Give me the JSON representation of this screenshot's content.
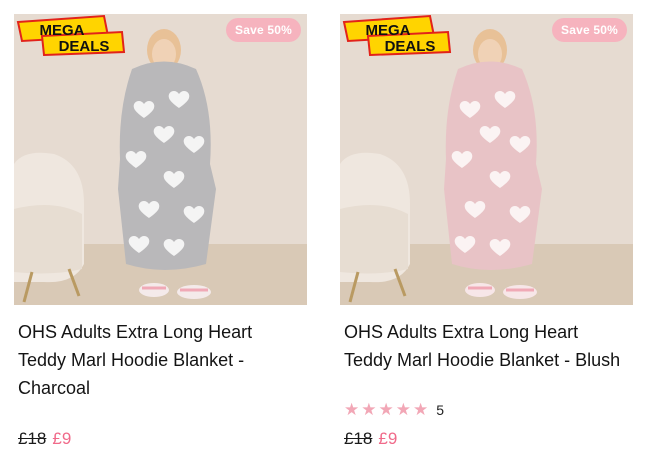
{
  "products": [
    {
      "badge": "Save 50%",
      "promo_top": "MEGA",
      "promo_bottom": "DEALS",
      "title": "OHS Adults Extra Long Heart Teddy Marl Hoodie Blanket - Charcoal",
      "old_price": "£18",
      "new_price": "£9",
      "color": "#b9b8ba"
    },
    {
      "badge": "Save 50%",
      "promo_top": "MEGA",
      "promo_bottom": "DEALS",
      "title": "OHS Adults Extra Long Heart Teddy Marl Hoodie Blanket - Blush",
      "rating_count": "5",
      "stars": 5,
      "old_price": "£18",
      "new_price": "£9",
      "color": "#e8c3c6"
    }
  ],
  "colors": {
    "accent_pink": "#f06a8a",
    "badge_pink": "#f6b3be",
    "star": "#f2a7b6",
    "mega_yellow": "#ffd400",
    "mega_red": "#e2231a"
  },
  "icons": {
    "star": "star-icon"
  }
}
